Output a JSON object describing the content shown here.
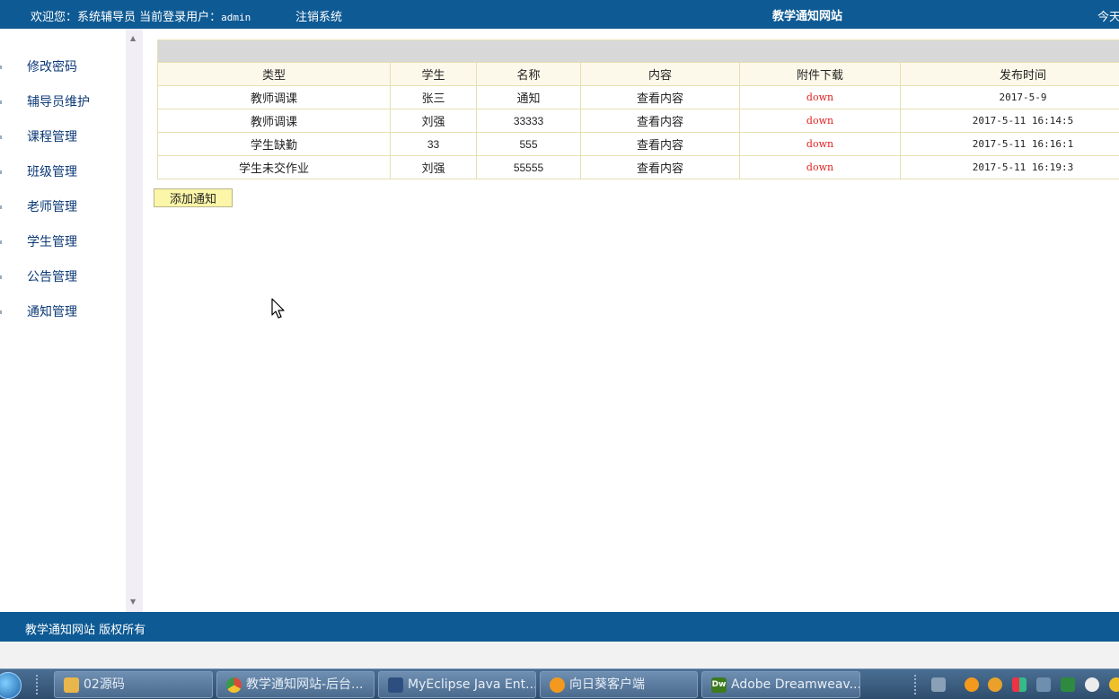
{
  "header": {
    "welcome_label": "欢迎您：系统辅导员",
    "current_user_label": "当前登录用户：",
    "username": "admin",
    "logout": "注销系统",
    "site_title": "教学通知网站",
    "today_label": "今天"
  },
  "sidebar": {
    "items": [
      {
        "label": "修改密码"
      },
      {
        "label": "辅导员维护"
      },
      {
        "label": "课程管理"
      },
      {
        "label": "班级管理"
      },
      {
        "label": "老师管理"
      },
      {
        "label": "学生管理"
      },
      {
        "label": "公告管理"
      },
      {
        "label": "通知管理"
      }
    ]
  },
  "table": {
    "columns": [
      "类型",
      "学生",
      "名称",
      "内容",
      "附件下载",
      "发布时间"
    ],
    "rows": [
      {
        "type": "教师调课",
        "student": "张三",
        "name": "通知",
        "content": "查看内容",
        "download": "down",
        "time": "2017-5-9"
      },
      {
        "type": "教师调课",
        "student": "刘强",
        "name": "33333",
        "content": "查看内容",
        "download": "down",
        "time": "2017-5-11 16:14:5"
      },
      {
        "type": "学生缺勤",
        "student": "33",
        "name": "555",
        "content": "查看内容",
        "download": "down",
        "time": "2017-5-11 16:16:1"
      },
      {
        "type": "学生未交作业",
        "student": "刘强",
        "name": "55555",
        "content": "查看内容",
        "download": "down",
        "time": "2017-5-11 16:19:3"
      }
    ]
  },
  "actions": {
    "add_notice": "添加通知"
  },
  "footer": {
    "copyright": "教学通知网站 版权所有"
  },
  "taskbar": {
    "items": [
      {
        "label": "02源码",
        "icon": "folder-icon",
        "color": "#e8b64a"
      },
      {
        "label": "教学通知网站-后台...",
        "icon": "chrome-icon",
        "color": "#d94c3a"
      },
      {
        "label": "MyEclipse Java Ent...",
        "icon": "myeclipse-icon",
        "color": "#2d4f80"
      },
      {
        "label": "向日葵客户端",
        "icon": "sunflower-icon",
        "color": "#f39a1e"
      },
      {
        "label": "Adobe Dreamweav...",
        "icon": "dreamweaver-icon",
        "color": "#3d7b1f"
      }
    ],
    "dw_icon_text": "Dw"
  },
  "colors": {
    "header_bg": "#0e5a94",
    "table_border": "#e5dfb1",
    "down_link": "#e02020",
    "button_bg": "#fbf6a8"
  }
}
